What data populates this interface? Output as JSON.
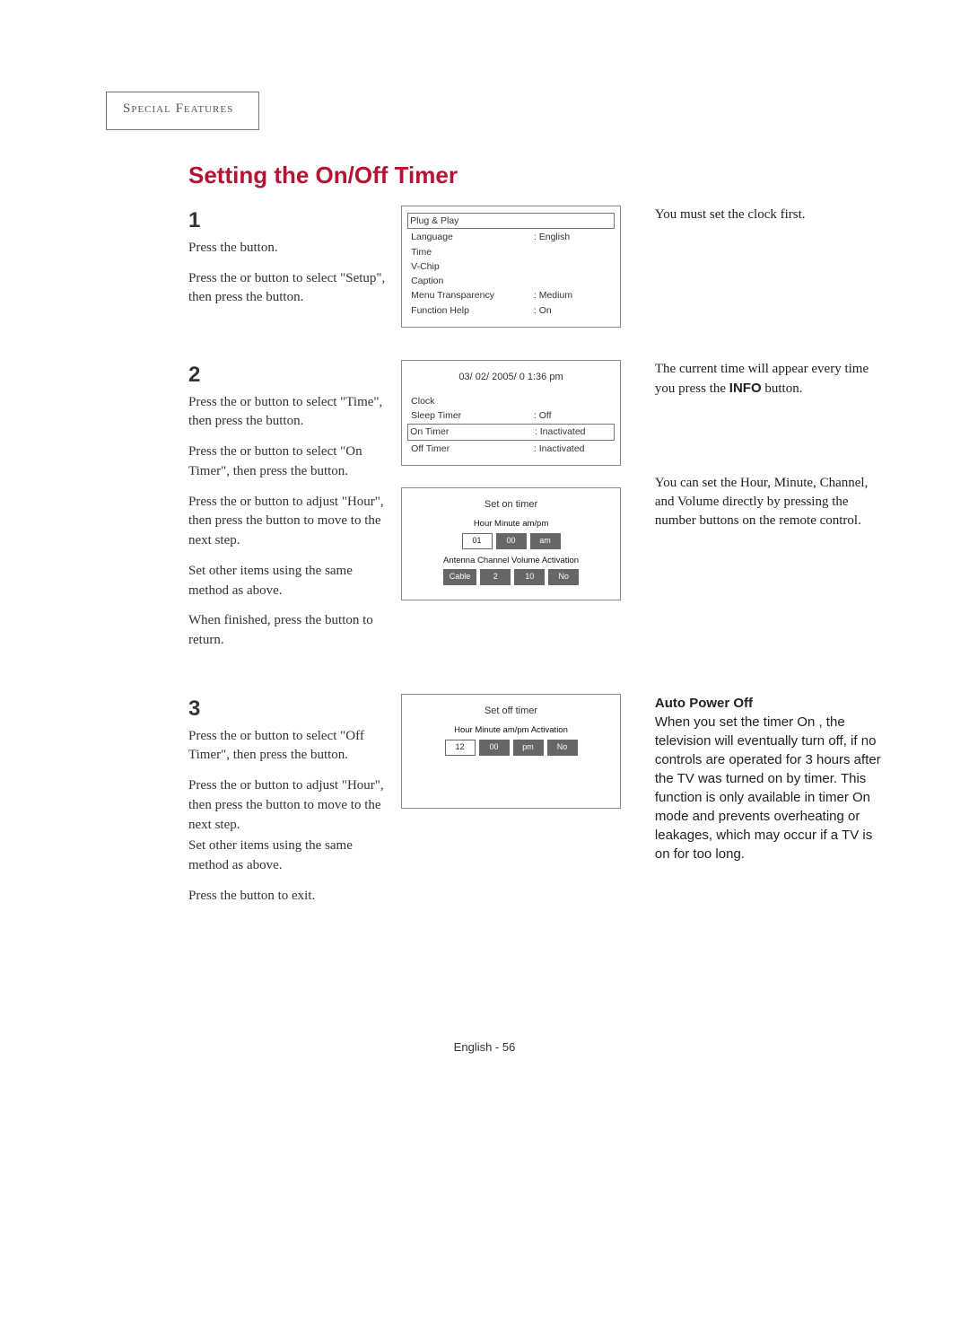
{
  "header": {
    "category": "Special Features",
    "title": "Setting the On/Off Timer"
  },
  "steps": {
    "s1": {
      "num": "1",
      "p1": "Press the  button.",
      "p2": "Press the  or  button to select \"Setup\", then press the  button."
    },
    "s2": {
      "num": "2",
      "p1": "Press the  or  button to select \"Time\", then press the  button.",
      "p2": "Press the  or  button to select \"On Timer\", then press the  button.",
      "p3": "Press the  or  button to adjust \"Hour\", then press the  button to move to the next step.",
      "p4": "Set other items using the same method as above.",
      "p5": "When finished, press the  button to return."
    },
    "s3": {
      "num": "3",
      "p1": "Press the  or  button to select \"Off Timer\", then press the  button.",
      "p2": "Press the  or  button to adjust \"Hour\", then press the  button to move to the next step.",
      "p3": "Set other items using the same method as above.",
      "p4": "Press the  button to exit."
    }
  },
  "osd": {
    "setup": {
      "rows": [
        {
          "label": "Plug & Play",
          "val": "",
          "boxed": true
        },
        {
          "label": "Language",
          "val": ": English"
        },
        {
          "label": "Time",
          "val": ""
        },
        {
          "label": "V-Chip",
          "val": ""
        },
        {
          "label": "Caption",
          "val": ""
        },
        {
          "label": "Menu Transparency",
          "val": ": Medium"
        },
        {
          "label": "Function Help",
          "val": ": On"
        }
      ]
    },
    "time": {
      "datetime": "03/ 02/ 2005/ 0 1:36  pm",
      "rows": [
        {
          "label": "Clock",
          "val": ""
        },
        {
          "label": "Sleep Timer",
          "val": ": Off"
        },
        {
          "label": "On Timer",
          "val": ": Inactivated",
          "boxed": true
        },
        {
          "label": "Off Timer",
          "val": ": Inactivated"
        }
      ]
    },
    "onTimer": {
      "title": "Set on timer",
      "head1": "Hour  Minute  am/pm",
      "row1": [
        "01",
        "00",
        "am"
      ],
      "head2": "Antenna Channel Volume Activation",
      "row2": [
        "Cable",
        "2",
        "10",
        "No"
      ]
    },
    "offTimer": {
      "title": "Set off timer",
      "head1": "Hour  Minute  am/pm  Activation",
      "row1": [
        "12",
        "00",
        "pm",
        "No"
      ]
    }
  },
  "notes": {
    "n1": "You must set the clock first.",
    "n2a": "The current time will appear every time you press the ",
    "n2b": "INFO",
    "n2c": " button.",
    "n3": "You can set the Hour, Minute, Channel, and Volume directly by pressing the number buttons on the remote control.",
    "n4title": "Auto Power Off",
    "n4body": "When you set the timer On , the television will eventually turn off, if no controls are operated for 3 hours after the TV was turned on by timer. This function is only available in timer On mode and prevents overheating or leakages, which may occur if a TV is on for too long."
  },
  "footer": "English - 56"
}
